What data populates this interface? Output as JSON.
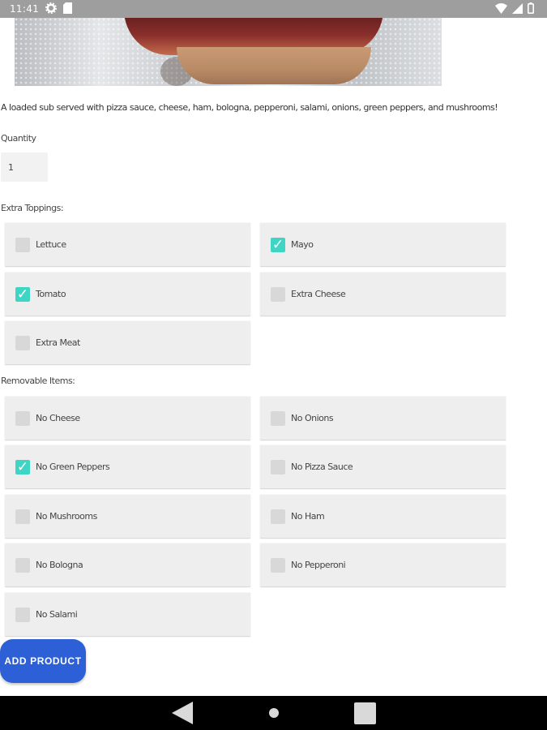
{
  "status_bar": {
    "time": "11:41"
  },
  "product": {
    "description": "A loaded sub served with pizza sauce, cheese, ham, bologna, pepperoni, salami, onions, green peppers, and mushrooms!"
  },
  "quantity": {
    "label": "Quantity",
    "value": "1"
  },
  "extra_toppings": {
    "label": "Extra Toppings:",
    "items": [
      {
        "label": "Lettuce",
        "checked": false
      },
      {
        "label": "Mayo",
        "checked": true
      },
      {
        "label": "Tomato",
        "checked": true
      },
      {
        "label": "Extra Cheese",
        "checked": false
      },
      {
        "label": "Extra Meat",
        "checked": false
      }
    ]
  },
  "removable_items": {
    "label": "Removable Items:",
    "items": [
      {
        "label": "No Cheese",
        "checked": false
      },
      {
        "label": "No Onions",
        "checked": false
      },
      {
        "label": "No Green Peppers",
        "checked": true
      },
      {
        "label": "No Pizza Sauce",
        "checked": false
      },
      {
        "label": "No Mushrooms",
        "checked": false
      },
      {
        "label": "No Ham",
        "checked": false
      },
      {
        "label": "No Bologna",
        "checked": false
      },
      {
        "label": "No Pepperoni",
        "checked": false
      },
      {
        "label": "No Salami",
        "checked": false
      }
    ]
  },
  "add_button": {
    "label": "ADD PRODUCT"
  },
  "colors": {
    "accent": "#2d5fd6",
    "checked": "#3fd5c4",
    "status_bar": "#9e9e9e"
  },
  "icons": [
    "settings-icon",
    "sd-card-icon",
    "wifi-icon",
    "signal-icon",
    "battery-icon",
    "back-icon",
    "home-icon",
    "recents-icon",
    "check-icon"
  ]
}
